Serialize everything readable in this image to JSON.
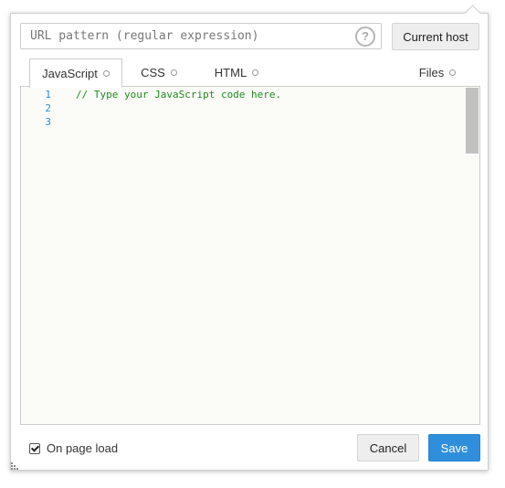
{
  "url_pattern": {
    "value": "",
    "placeholder": "URL pattern (regular expression)",
    "help_icon": "question-circle-icon",
    "help_glyph": "?"
  },
  "current_host_label": "Current host",
  "tabs": [
    {
      "label": "JavaScript",
      "active": true
    },
    {
      "label": "CSS",
      "active": false
    },
    {
      "label": "HTML",
      "active": false
    },
    {
      "label": "Files",
      "active": false
    }
  ],
  "editor": {
    "line_numbers": [
      "1",
      "2",
      "3"
    ],
    "lines": [
      "// Type your JavaScript code here.",
      "",
      ""
    ]
  },
  "footer": {
    "on_page_load_label": "On page load",
    "on_page_load_checked": true,
    "cancel_label": "Cancel",
    "save_label": "Save"
  },
  "colors": {
    "save_button": "#2f8fdd",
    "line_number": "#2a8fd4",
    "comment": "#1f8a1f",
    "editor_bg": "#fbfbf8"
  }
}
